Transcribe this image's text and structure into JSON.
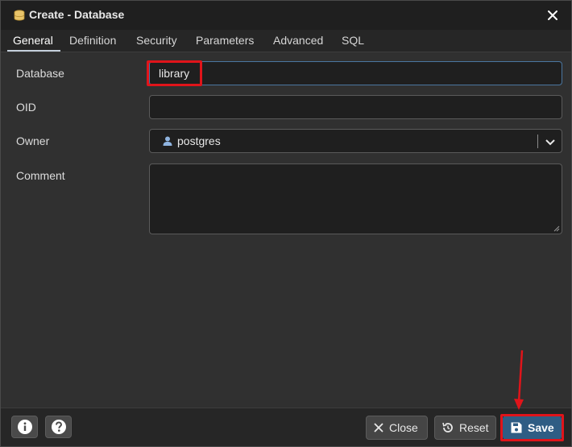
{
  "window": {
    "title": "Create - Database",
    "icon": "database-icon"
  },
  "tabs": [
    {
      "label": "General"
    },
    {
      "label": "Definition"
    },
    {
      "label": "Security"
    },
    {
      "label": "Parameters"
    },
    {
      "label": "Advanced"
    },
    {
      "label": "SQL"
    }
  ],
  "form": {
    "database": {
      "label": "Database",
      "value": "library"
    },
    "oid": {
      "label": "OID",
      "value": ""
    },
    "owner": {
      "label": "Owner",
      "value": "postgres"
    },
    "comment": {
      "label": "Comment",
      "value": ""
    }
  },
  "footer": {
    "close_label": "Close",
    "reset_label": "Reset",
    "save_label": "Save"
  },
  "colors": {
    "accent": "#2f5d84",
    "highlight": "#e0141a",
    "background": "#303030"
  }
}
